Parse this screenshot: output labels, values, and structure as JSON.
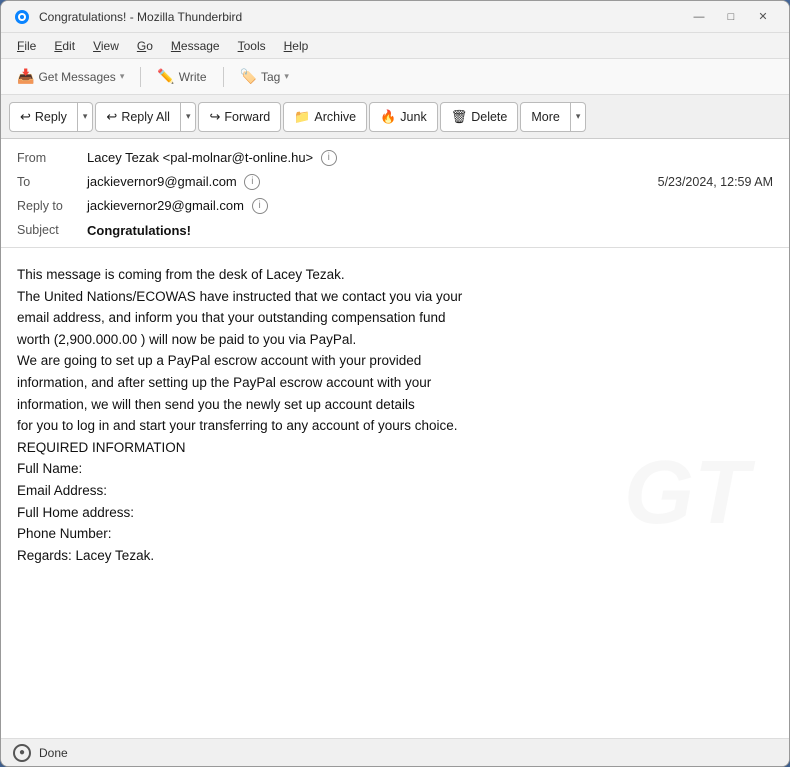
{
  "window": {
    "title": "Congratulations! - Mozilla Thunderbird",
    "icon": "thunderbird"
  },
  "titlebar": {
    "title": "Congratulations! - Mozilla Thunderbird",
    "minimize_label": "—",
    "maximize_label": "□",
    "close_label": "✕"
  },
  "menubar": {
    "items": [
      "File",
      "Edit",
      "View",
      "Go",
      "Message",
      "Tools",
      "Help"
    ]
  },
  "toolbar1": {
    "get_messages_label": "Get Messages",
    "write_label": "Write",
    "tag_label": "Tag"
  },
  "toolbar2": {
    "reply_label": "Reply",
    "reply_all_label": "Reply All",
    "forward_label": "Forward",
    "archive_label": "Archive",
    "junk_label": "Junk",
    "delete_label": "Delete",
    "more_label": "More"
  },
  "email": {
    "from_label": "From",
    "from_value": "Lacey Tezak <pal-molnar@t-online.hu>",
    "to_label": "To",
    "to_value": "jackievernor9@gmail.com",
    "date_value": "5/23/2024, 12:59 AM",
    "reply_to_label": "Reply to",
    "reply_to_value": "jackievernor29@gmail.com",
    "subject_label": "Subject",
    "subject_value": "Congratulations!",
    "body": "This message is coming from the desk of Lacey Tezak.\nThe United Nations/ECOWAS have instructed that we contact you via your email address, and inform you that your outstanding compensation fund worth (2,900.000.00 ) will now be paid to you via PayPal.\nWe are going to set up a PayPal escrow account with your provided information, and after setting up the PayPal escrow account with your information, we will then send you the newly set up account details for you to log in and start your transferring to any account of yours choice.\nREQUIRED INFORMATION\nFull Name:\nEmail Address:\nFull Home address:\nPhone Number:\nRegards: Lacey Tezak."
  },
  "statusbar": {
    "status_text": "Done",
    "status_icon": "(●)"
  },
  "icons": {
    "reply": "↩",
    "forward": "↪",
    "archive": "🗃",
    "junk": "🔥",
    "delete": "🗑",
    "more_chevron": "▼",
    "chevron_down": "▾",
    "write_pencil": "✏",
    "tag": "🏷",
    "contact": "i"
  }
}
